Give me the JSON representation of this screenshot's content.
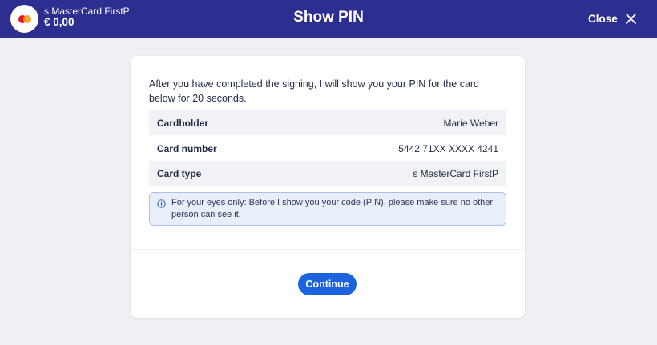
{
  "header": {
    "account_name": "s MasterCard FirstP",
    "balance": "€ 0,00",
    "title": "Show PIN",
    "close_label": "Close"
  },
  "dialog": {
    "intro_text": "After you have completed the signing, I will show you your PIN for the card below for 20 seconds.",
    "details": [
      {
        "label": "Cardholder",
        "value": "Marie Weber"
      },
      {
        "label": "Card number",
        "value": "5442 71XX XXXX 4241"
      },
      {
        "label": "Card type",
        "value": "s MasterCard FirstP"
      }
    ],
    "notice": "For your eyes only: Before I show you your code (PIN), please make sure no other person can see it.",
    "continue_label": "Continue"
  },
  "colors": {
    "header_bg": "#2c2f8f",
    "page_bg": "#eef0f4",
    "primary_button": "#1c64de",
    "notice_bg": "#e8effb",
    "notice_border": "#a9c1ee"
  },
  "icons": {
    "card_logo": "mastercard-logo-icon",
    "close": "close-icon",
    "notice": "info-icon"
  }
}
